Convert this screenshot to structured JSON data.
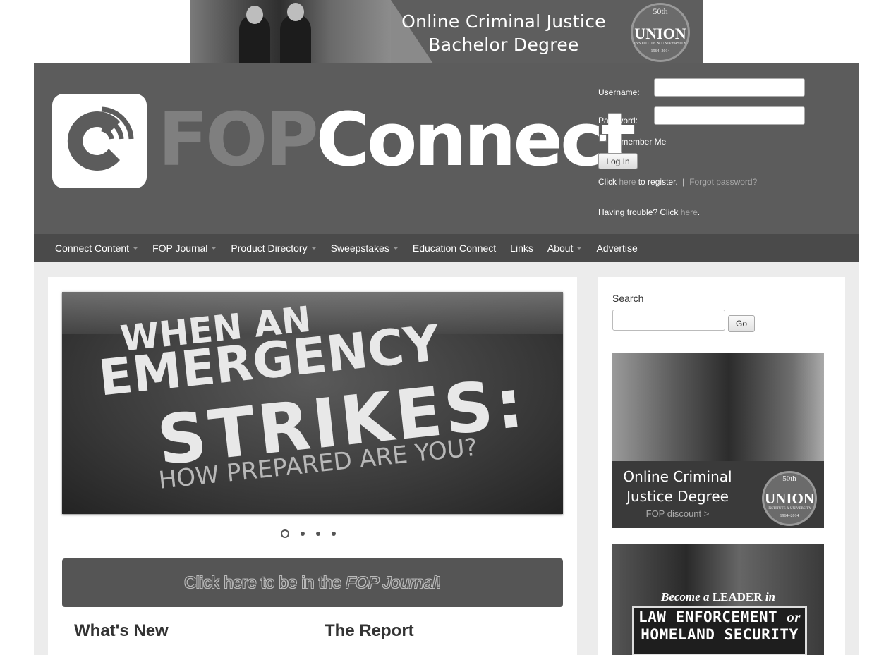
{
  "top_ad": {
    "line1": "Online Criminal Justice",
    "line2": "Bachelor Degree",
    "brand": "UNION",
    "brand_sub": "INSTITUTE & UNIVERSITY",
    "anniv": "50th",
    "years": "1964–2014"
  },
  "header": {
    "logo_fop": "FOP",
    "logo_connect": "Connect",
    "login": {
      "username_label": "Username:",
      "password_label": "Password:",
      "remember_label": "Remember Me",
      "login_button": "Log In",
      "register_prefix": "Click",
      "register_link": "here",
      "register_suffix": "to register.",
      "separator": "|",
      "forgot_link": "Forgot password?",
      "trouble_prefix": "Having trouble? Click",
      "trouble_link": "here",
      "trouble_suffix": "."
    }
  },
  "nav": {
    "items": [
      {
        "label": "Connect Content",
        "dropdown": true
      },
      {
        "label": "FOP Journal",
        "dropdown": true
      },
      {
        "label": "Product Directory",
        "dropdown": true
      },
      {
        "label": "Sweepstakes",
        "dropdown": true
      },
      {
        "label": "Education Connect",
        "dropdown": false
      },
      {
        "label": "Links",
        "dropdown": false
      },
      {
        "label": "About",
        "dropdown": true
      },
      {
        "label": "Advertise",
        "dropdown": false
      }
    ]
  },
  "slider": {
    "line1": "WHEN AN",
    "line2": "EMERGENCY",
    "line3": "STRIKES:",
    "line4": "HOW PREPARED ARE YOU?",
    "slide_count": 4,
    "active_index": 0
  },
  "cta": {
    "prefix": "Click here to be in the ",
    "italic": "FOP Journal",
    "suffix": "!"
  },
  "columns": {
    "left_title": "What's New",
    "right_title": "The Report"
  },
  "sidebar": {
    "search_label": "Search",
    "go_button": "Go",
    "ad1": {
      "line1": "Online Criminal",
      "line2": "Justice Degree",
      "sub": "FOP discount >",
      "brand": "UNION",
      "brand_sub": "INSTITUTE & UNIVERSITY",
      "anniv": "50th",
      "years": "1964–2014"
    },
    "ad2": {
      "lead_a": "Become a ",
      "lead_b": "LEADER",
      "lead_c": " in",
      "line1a": "LAW ENFORCEMENT ",
      "line1b": "or",
      "line2": "HOMELAND SECURITY"
    }
  }
}
